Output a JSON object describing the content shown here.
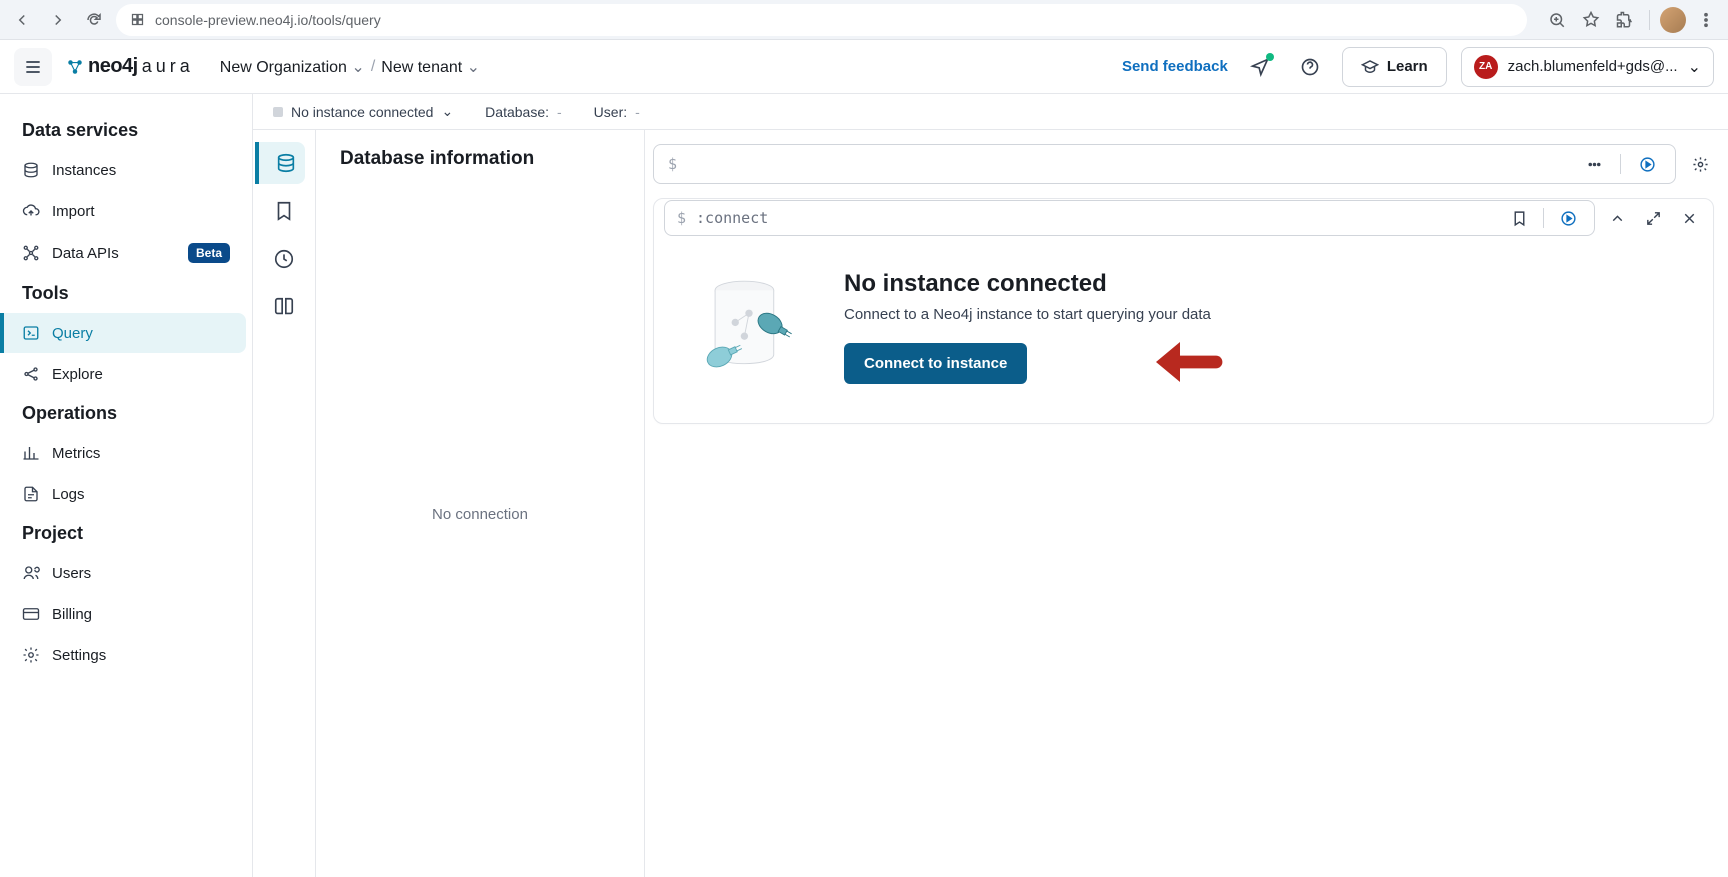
{
  "browser": {
    "url": "console-preview.neo4j.io/tools/query"
  },
  "header": {
    "org": "New Organization",
    "tenant": "New tenant",
    "feedback": "Send feedback",
    "learn": "Learn",
    "user_initials": "ZA",
    "user_email": "zach.blumenfeld+gds@..."
  },
  "sidebar": {
    "sections": {
      "data_services": "Data services",
      "tools": "Tools",
      "operations": "Operations",
      "project": "Project"
    },
    "items": {
      "instances": "Instances",
      "import": "Import",
      "data_apis": "Data APIs",
      "data_apis_badge": "Beta",
      "query": "Query",
      "explore": "Explore",
      "metrics": "Metrics",
      "logs": "Logs",
      "users": "Users",
      "billing": "Billing",
      "settings": "Settings"
    }
  },
  "status": {
    "connection": "No instance connected",
    "database_label": "Database:",
    "database_value": "-",
    "user_label": "User:",
    "user_value": "-"
  },
  "info_panel": {
    "title": "Database information",
    "empty": "No connection"
  },
  "cmd": {
    "prompt": "$",
    "connect_cmd": ":connect"
  },
  "result": {
    "title": "No instance connected",
    "subtitle": "Connect to a Neo4j instance to start querying your data",
    "button": "Connect to instance"
  }
}
